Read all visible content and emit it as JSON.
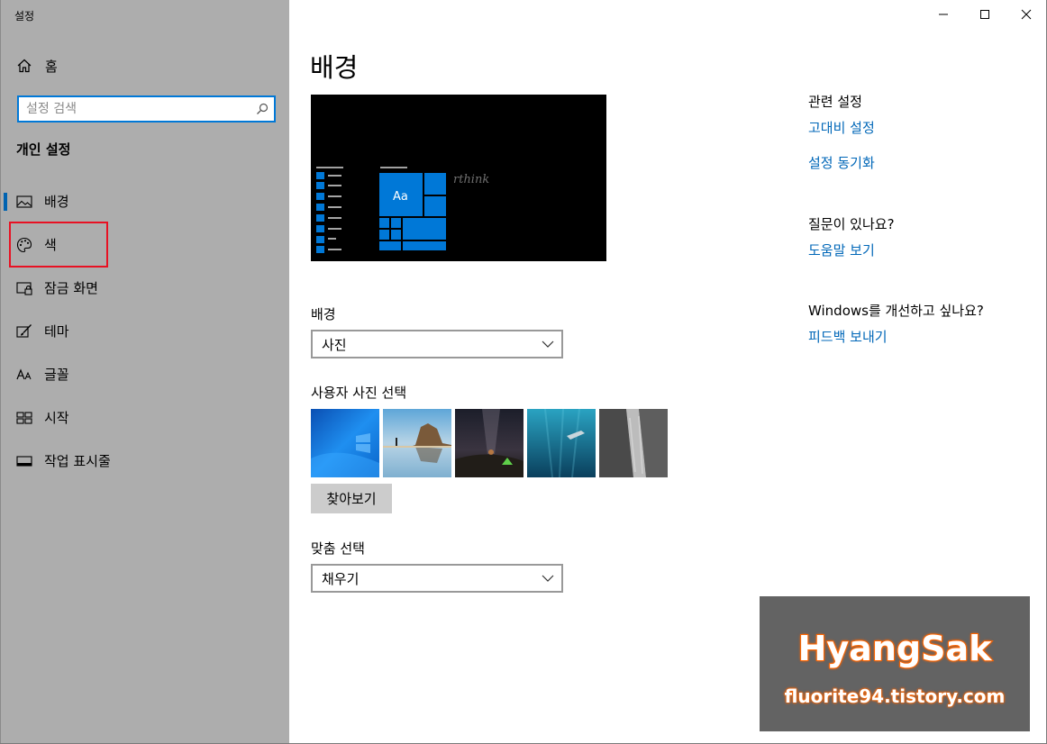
{
  "window": {
    "title": "설정",
    "controls": [
      "minimize-icon",
      "maximize-icon",
      "close-icon"
    ]
  },
  "sidebar": {
    "home_label": "홈",
    "search_placeholder": "설정 검색",
    "section_title": "개인 설정",
    "items": [
      {
        "label": "배경",
        "icon": "picture-icon",
        "selected": true
      },
      {
        "label": "색",
        "icon": "palette-icon",
        "selected": false
      },
      {
        "label": "잠금 화면",
        "icon": "lock-screen-icon",
        "selected": false
      },
      {
        "label": "테마",
        "icon": "theme-brush-icon",
        "selected": false
      },
      {
        "label": "글꼴",
        "icon": "font-icon",
        "selected": false
      },
      {
        "label": "시작",
        "icon": "start-menu-icon",
        "selected": false
      },
      {
        "label": "작업 표시줄",
        "icon": "taskbar-icon",
        "selected": false
      }
    ]
  },
  "main": {
    "page_title": "배경",
    "preview": {
      "tile_label": "Aa",
      "overlay_text": "rthink"
    },
    "background": {
      "label": "배경",
      "value": "사진"
    },
    "picture": {
      "label": "사용자 사진 선택",
      "thumbnails": [
        "windows-blue-wallpaper",
        "beach-rocks-wallpaper",
        "night-sky-tent-wallpaper",
        "underwater-swimmer-wallpaper",
        "rock-cliff-wallpaper"
      ],
      "browse_label": "찾아보기"
    },
    "fit": {
      "label": "맞춤 선택",
      "value": "채우기"
    }
  },
  "related": {
    "heading": "관련 설정",
    "links": [
      "고대비 설정",
      "설정 동기화"
    ],
    "question_heading": "질문이 있나요?",
    "help_link": "도움말 보기",
    "feedback_heading": "Windows를 개선하고 싶나요?",
    "feedback_link": "피드백 보내기"
  },
  "watermark": {
    "title": "HyangSak",
    "url": "fluorite94.tistory.com"
  },
  "colors": {
    "accent": "#0078d7",
    "link": "#0067b8",
    "sidebar_bg": "#adadad",
    "highlight": "#e81123",
    "watermark_stroke": "#ff6600"
  }
}
